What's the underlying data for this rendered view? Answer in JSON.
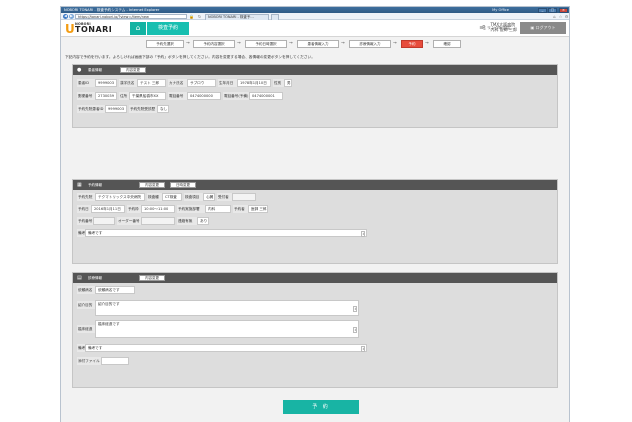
{
  "browser": {
    "window_title": "NOBORI TONARI - 検査予約システム - Internet Explorer",
    "user_label": "My Office",
    "url": "https://tonari.nobori.io/?view=/item/new",
    "tab_label": "NOBORI TONARI - 検査予...",
    "controls": [
      "_",
      "□",
      "×"
    ]
  },
  "header": {
    "logo_small": "NOBORI",
    "logo_big": "TONARI",
    "logo_glyph": "U",
    "home_icon": "⌂",
    "active_tab": "検査予約",
    "menu_icon": "☰",
    "link_label": "リンク",
    "settings_label": "設定",
    "org_line1": "TMX大阪病院",
    "org_line2": "内科 医師 三郎",
    "logout_label": "ログアウト"
  },
  "steps": [
    {
      "label": "予約先選択",
      "active": false
    },
    {
      "label": "予約内容選択",
      "active": false
    },
    {
      "label": "予約日時選択",
      "active": false
    },
    {
      "label": "患者情報入力",
      "active": false
    },
    {
      "label": "診療情報入力",
      "active": false
    },
    {
      "label": "予約",
      "active": true
    },
    {
      "label": "確認",
      "active": false
    }
  ],
  "notice": "下記内容で予約を行います。よろしければ画面下部の「予約」ボタンを押してください。内容を変更する場合、各情報の変更ボタンを押してください。",
  "patient": {
    "title": "患者情報",
    "edit_button": "内容変更",
    "fields": {
      "patient_id_label": "患者ID",
      "patient_id": "9999003",
      "kanji_label": "漢字氏名",
      "kanji_name": "テスト 三郎",
      "kana_label": "カナ氏名",
      "kana_name": "サブロウ",
      "dob_label": "生年月日",
      "dob": "1978年1月10日",
      "sex_label": "性別",
      "sex": "男",
      "zip_label": "郵便番号",
      "zip": "2730039",
      "addr_label": "住所",
      "addr": "千葉県船橋市XX",
      "tel_label": "電話番号",
      "tel": "0474000000",
      "mobile_label": "電話番号(予備)",
      "mobile": "0474000001",
      "ext_id_label": "予約先院患者ID",
      "ext_id": "9999003",
      "consent_label": "予約先院受診歴",
      "consent": "なし"
    }
  },
  "reservation": {
    "title": "予約情報",
    "edit_button": "内容変更",
    "edit_date_button": "日時変更",
    "fields": {
      "dest_label": "予約先院",
      "dest": "テクマトリックス中央病院",
      "device_label": "検査種",
      "device": "CT検査",
      "item_label": "検査項目",
      "item": "心臓",
      "reception_label": "受付者",
      "reception": "",
      "date_label": "予約日",
      "date": "2016年1月11日",
      "time_label": "予約枠",
      "time": "10:00〜11:00",
      "dept_label": "予約実施部署",
      "dept": "内科",
      "doctor_label": "予約者",
      "doctor": "医師 三郎",
      "resno_label": "予約番号",
      "resno": "",
      "order_label": "オーダー番号",
      "order": "",
      "contact_label": "連絡有無",
      "contact": "あり",
      "memo_label": "備考",
      "memo": "備考です"
    }
  },
  "clinical": {
    "title": "診療情報",
    "edit_button": "内容変更",
    "fields": {
      "disease_label": "依頼病名",
      "disease": "依頼病名です",
      "purpose_label": "紹介目的",
      "purpose": "紹介目的です",
      "history_label": "臨床経過",
      "history": "臨床経過です",
      "memo_label": "備考",
      "memo": "備考です",
      "attach_label": "添付ファイル",
      "attach": ""
    }
  },
  "submit_label": "予 約"
}
